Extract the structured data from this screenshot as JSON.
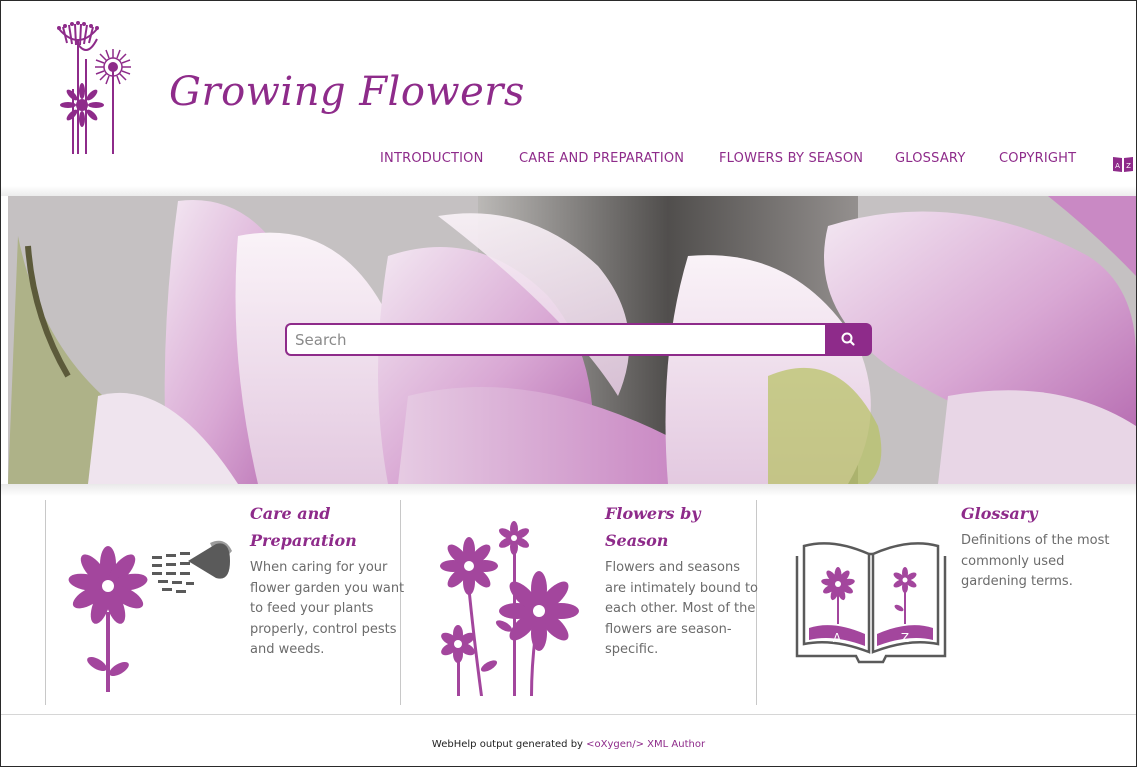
{
  "header": {
    "site_title": "Growing Flowers",
    "nav": [
      "INTRODUCTION",
      "CARE AND PREPARATION",
      "FLOWERS BY SEASON",
      "GLOSSARY",
      "COPYRIGHT"
    ],
    "index_icon_text": "A Z"
  },
  "search": {
    "placeholder": "Search"
  },
  "tiles": [
    {
      "title": "Care and Preparation",
      "description": "When caring for your flower garden you want to feed your plants properly, control pests and weeds."
    },
    {
      "title": "Flowers by Season",
      "description": "Flowers and seasons are intimately bound to each other. Most of the flowers are season-specific."
    },
    {
      "title": "Glossary",
      "description": "Definitions of the most commonly used gardening terms."
    }
  ],
  "glossary_book": {
    "left_letter": "A",
    "right_letter": "Z"
  },
  "footer": {
    "prefix": "WebHelp output generated by ",
    "link_text": "<oXygen/> XML Author"
  },
  "colors": {
    "accent": "#8e2b8a",
    "text_gray": "#6b6b6b",
    "illustration_gray": "#5a5a5a"
  }
}
